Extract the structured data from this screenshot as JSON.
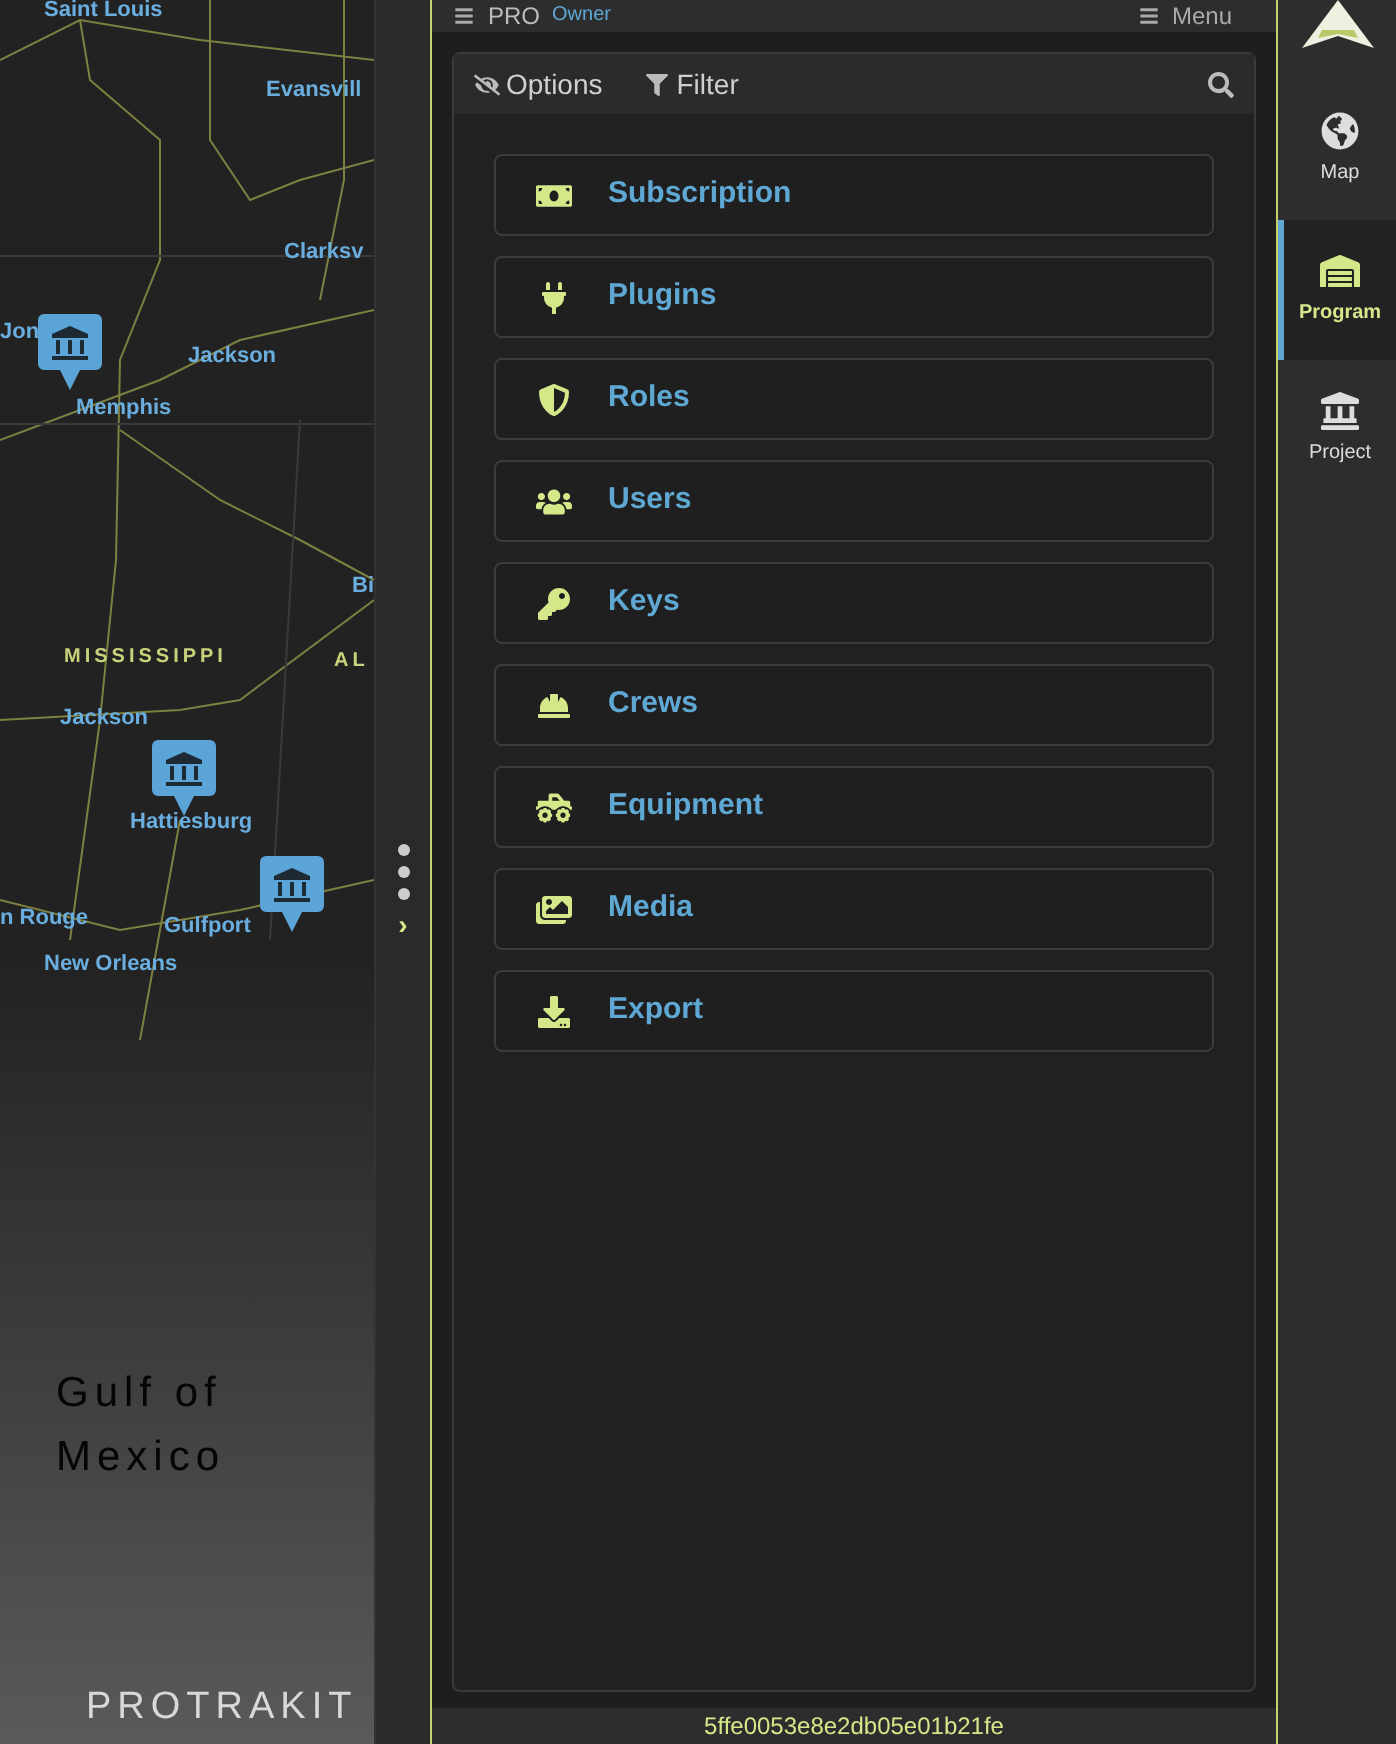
{
  "map": {
    "labels": [
      {
        "text": "Saint Louis",
        "kind": "city"
      },
      {
        "text": "Evansvill",
        "kind": "city"
      },
      {
        "text": "Clarksv",
        "kind": "city"
      },
      {
        "text": "Jon",
        "kind": "city"
      },
      {
        "text": "Jackson",
        "kind": "city"
      },
      {
        "text": "Memphis",
        "kind": "city"
      },
      {
        "text": "Bi",
        "kind": "city"
      },
      {
        "text": "MISSISSIPPI",
        "kind": "state"
      },
      {
        "text": "AL",
        "kind": "state"
      },
      {
        "text": "Jackson",
        "kind": "city"
      },
      {
        "text": "Hattiesburg",
        "kind": "city"
      },
      {
        "text": "n Rouge",
        "kind": "city"
      },
      {
        "text": "Gulfport",
        "kind": "city"
      },
      {
        "text": "New Orleans",
        "kind": "city"
      },
      {
        "text": "Gulf of",
        "kind": "water"
      },
      {
        "text": "Mexico",
        "kind": "water"
      }
    ],
    "brand": "PROTRAKIT"
  },
  "splitter": {
    "handle": "›"
  },
  "panel": {
    "header": {
      "title": "PRO",
      "subtitle": "Owner",
      "menu": "Menu"
    },
    "toolbar": {
      "options": "Options",
      "filter": "Filter"
    },
    "items": [
      {
        "label": "Subscription"
      },
      {
        "label": "Plugins"
      },
      {
        "label": "Roles"
      },
      {
        "label": "Users"
      },
      {
        "label": "Keys"
      },
      {
        "label": "Crews"
      },
      {
        "label": "Equipment"
      },
      {
        "label": "Media"
      },
      {
        "label": "Export"
      }
    ],
    "footer": "5ffe0053e8e2db05e01b21fe"
  },
  "nav": [
    {
      "label": "Map",
      "selected": false
    },
    {
      "label": "Program",
      "selected": true
    },
    {
      "label": "Project",
      "selected": false
    }
  ]
}
